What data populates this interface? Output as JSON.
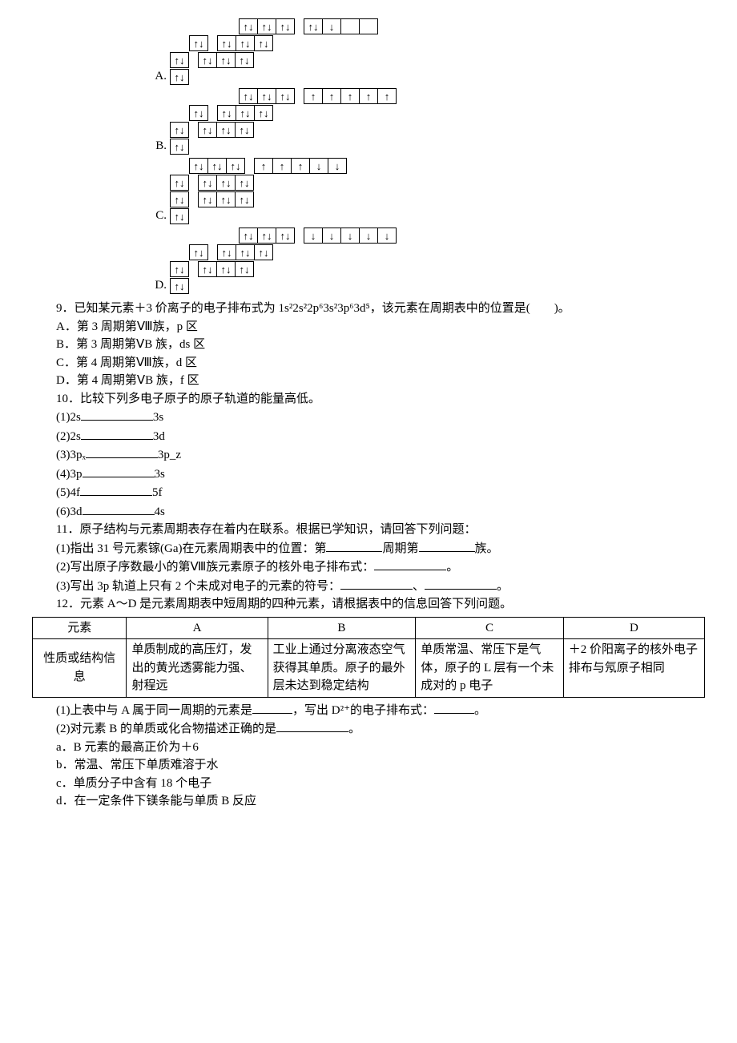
{
  "q8": {
    "options": {
      "A": {
        "label": "A.",
        "rows": [
          {
            "offset": 2,
            "groups": [
              [
                "↑↓",
                "↑↓",
                "↑↓"
              ],
              [
                "↑↓",
                "↓",
                "",
                ""
              ]
            ]
          },
          {
            "offset": 1,
            "groups": [
              [
                "↑↓"
              ],
              [
                "↑↓",
                "↑↓",
                "↑↓"
              ]
            ]
          },
          {
            "offset": 0,
            "groups": [
              [
                "↑↓"
              ],
              [
                "↑↓",
                "↑↓",
                "↑↓"
              ]
            ]
          },
          {
            "offset": 0,
            "groups": [
              [
                "↑↓"
              ]
            ]
          }
        ]
      },
      "B": {
        "label": "B.",
        "rows": [
          {
            "offset": 2,
            "groups": [
              [
                "↑↓",
                "↑↓",
                "↑↓"
              ],
              [
                "↑",
                "↑",
                "↑",
                "↑",
                "↑"
              ]
            ]
          },
          {
            "offset": 1,
            "groups": [
              [
                "↑↓"
              ],
              [
                "↑↓",
                "↑↓",
                "↑↓"
              ]
            ]
          },
          {
            "offset": 0,
            "groups": [
              [
                "↑↓"
              ],
              [
                "↑↓",
                "↑↓",
                "↑↓"
              ]
            ]
          },
          {
            "offset": 0,
            "groups": [
              [
                "↑↓"
              ]
            ]
          }
        ]
      },
      "C": {
        "label": "C.",
        "rows": [
          {
            "offset": 1,
            "groups": [
              [
                "↑↓",
                "↑↓",
                "↑↓"
              ],
              [
                "↑",
                "↑",
                "↑",
                "↓",
                "↓"
              ]
            ]
          },
          {
            "offset": 0,
            "groups": [
              [
                "↑↓"
              ],
              [
                "↑↓",
                "↑↓",
                "↑↓"
              ]
            ]
          },
          {
            "offset": 0,
            "groups": [
              [
                "↑↓"
              ],
              [
                "↑↓",
                "↑↓",
                "↑↓"
              ]
            ]
          },
          {
            "offset": 0,
            "groups": [
              [
                "↑↓"
              ]
            ]
          }
        ]
      },
      "D": {
        "label": "D.",
        "rows": [
          {
            "offset": 2,
            "groups": [
              [
                "↑↓",
                "↑↓",
                "↑↓"
              ],
              [
                "↓",
                "↓",
                "↓",
                "↓",
                "↓"
              ]
            ]
          },
          {
            "offset": 1,
            "groups": [
              [
                "↑↓"
              ],
              [
                "↑↓",
                "↑↓",
                "↑↓"
              ]
            ]
          },
          {
            "offset": 0,
            "groups": [
              [
                "↑↓"
              ],
              [
                "↑↓",
                "↑↓",
                "↑↓"
              ]
            ]
          },
          {
            "offset": 0,
            "groups": [
              [
                "↑↓"
              ]
            ]
          }
        ]
      }
    }
  },
  "q9": {
    "stem": "9．已知某元素＋3 价离子的电子排布式为 1s²2s²2p⁶3s²3p⁶3d⁵，该元素在周期表中的位置是(　　)。",
    "A": "A．第 3 周期第Ⅷ族，p 区",
    "B": "B．第 3 周期第ⅤB 族，ds 区",
    "C": "C．第 4 周期第Ⅷ族，d 区",
    "D": "D．第 4 周期第ⅤB 族，f 区"
  },
  "q10": {
    "stem": "10．比较下列多电子原子的原子轨道的能量高低。",
    "i1a": "(1)2s",
    "i1b": "3s",
    "i2a": "(2)2s",
    "i2b": "3d",
    "i3a": "(3)3pₓ",
    "i3b": "3p_z",
    "i4a": "(4)3p",
    "i4b": "3s",
    "i5a": "(5)4f",
    "i5b": "5f",
    "i6a": "(6)3d",
    "i6b": "4s"
  },
  "q11": {
    "stem": "11．原子结构与元素周期表存在着内在联系。根据已学知识，请回答下列问题：",
    "p1a": "(1)指出 31 号元素镓(Ga)在元素周期表中的位置：第",
    "p1b": "周期第",
    "p1c": "族。",
    "p2a": "(2)写出原子序数最小的第Ⅷ族元素原子的核外电子排布式：",
    "p2b": "。",
    "p3a": "(3)写出 3p 轨道上只有 2 个未成对电子的元素的符号：",
    "p3b": "、",
    "p3c": "。"
  },
  "q12": {
    "stem": "12．元素 A～D 是元素周期表中短周期的四种元素，请根据表中的信息回答下列问题。",
    "th0": "元素",
    "thA": "A",
    "thB": "B",
    "thC": "C",
    "thD": "D",
    "rowh": "性质或结构信息",
    "cA": "单质制成的高压灯，发出的黄光透雾能力强、射程远",
    "cB": "工业上通过分离液态空气获得其单质。原子的最外层未达到稳定结构",
    "cC": "单质常温、常压下是气体，原子的 L 层有一个未成对的 p 电子",
    "cD": "＋2 价阳离子的核外电子排布与氖原子相同",
    "p1a": "(1)上表中与 A 属于同一周期的元素是",
    "p1b": "，写出 D²⁺的电子排布式：",
    "p1c": "。",
    "p2a": "(2)对元素 B 的单质或化合物描述正确的是",
    "p2b": "。",
    "a": "a．B 元素的最高正价为＋6",
    "b": "b．常温、常压下单质难溶于水",
    "c": "c．单质分子中含有 18 个电子",
    "d": "d．在一定条件下镁条能与单质 B 反应"
  }
}
